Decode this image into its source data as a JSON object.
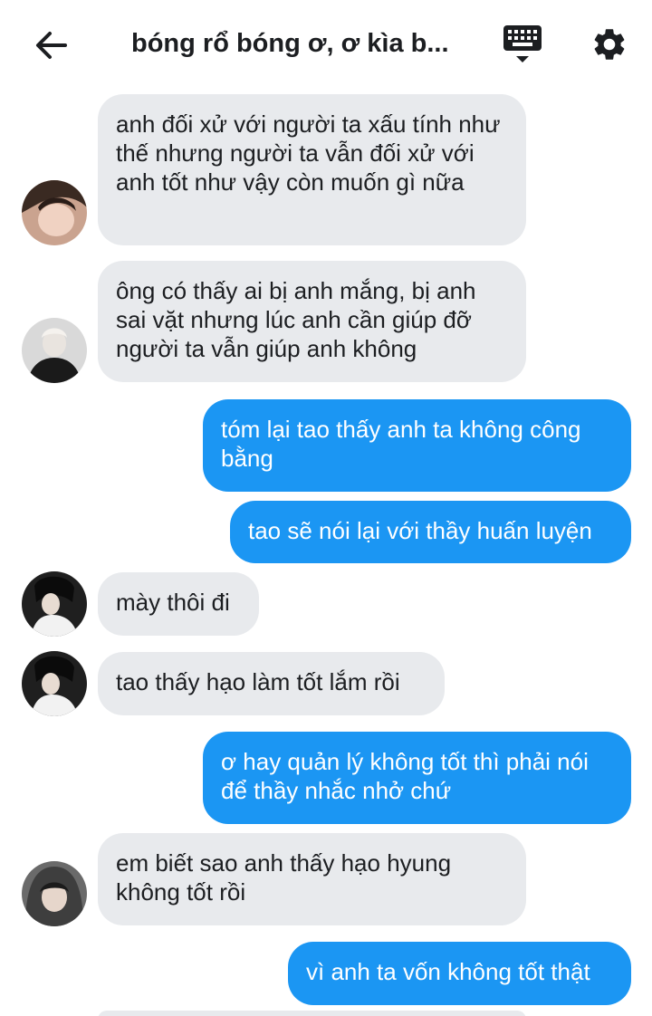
{
  "header": {
    "title": "bóng rổ bóng ơ, ơ kìa b...",
    "back_icon": "back-arrow-icon",
    "keyboard_icon": "keyboard-icon",
    "settings_icon": "gear-icon"
  },
  "colors": {
    "incoming_bubble": "#e8eaed",
    "outgoing_bubble": "#1b96f3"
  },
  "messages": [
    {
      "text": "anh đối xử với người ta xấu tính như thế nhưng người ta vẫn đối xử với anh tốt như vậy còn muốn gì nữa"
    },
    {
      "text": "ông có thấy ai bị anh mắng, bị anh sai vặt nhưng lúc anh cần giúp đỡ người ta vẫn giúp anh không"
    },
    {
      "text": "tóm lại tao thấy anh ta không công bằng"
    },
    {
      "text": "tao sẽ nói lại với thầy huấn luyện"
    },
    {
      "text": "mày thôi đi"
    },
    {
      "text": "tao thấy hạo làm tốt lắm rồi"
    },
    {
      "text": "ơ hay quản lý không tốt thì phải nói để thầy nhắc nhở chứ"
    },
    {
      "text": "em biết sao anh thấy hạo hyung không tốt rồi"
    },
    {
      "text": "vì anh ta vốn không tốt thật"
    }
  ]
}
